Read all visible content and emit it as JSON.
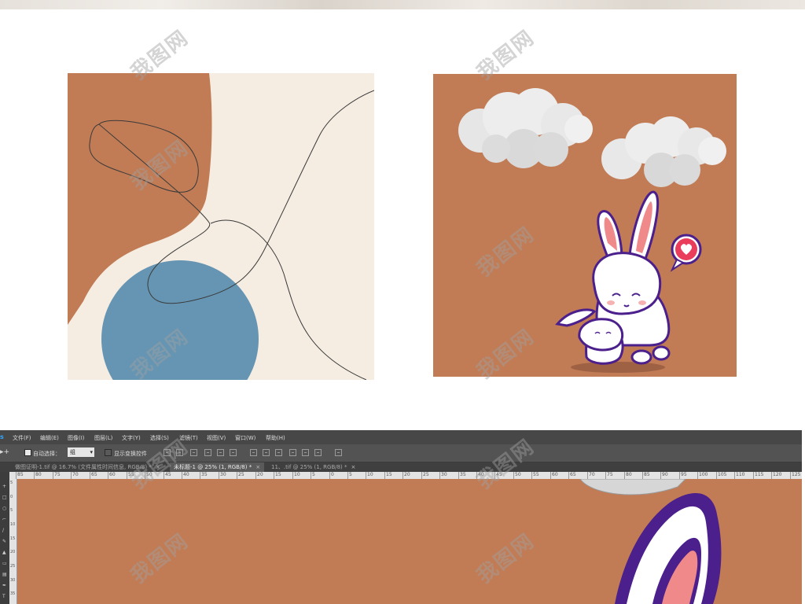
{
  "photoshop": {
    "app_glyph": "s",
    "menu": [
      "文件(F)",
      "编辑(E)",
      "图像(I)",
      "图层(L)",
      "文字(Y)",
      "选择(S)",
      "滤镜(T)",
      "视图(V)",
      "窗口(W)",
      "帮助(H)"
    ],
    "options": {
      "auto_select_label": "自动选择：",
      "auto_select_value": "组",
      "show_transform_label": "显示变换控件"
    },
    "tabs": [
      {
        "label": "做图证明-1.tif @ 16.7% (文件属性时间信息, RGB/8) *",
        "close": "×"
      },
      {
        "label": "未标题-1 @ 25% (1, RGB/8) *",
        "close": "×"
      },
      {
        "label": "11、.tif @ 25% (1, RGB/8) *",
        "close": "×"
      }
    ],
    "ruler_h_ticks": [
      "85",
      "80",
      "75",
      "70",
      "65",
      "60",
      "55",
      "50",
      "45",
      "40",
      "35",
      "30",
      "25",
      "20",
      "15",
      "10",
      "5",
      "0",
      "5",
      "10",
      "15",
      "20",
      "25",
      "30",
      "35",
      "40",
      "45",
      "50",
      "55",
      "60",
      "65",
      "70",
      "75",
      "80",
      "85",
      "90",
      "95",
      "100",
      "105",
      "110",
      "115",
      "120",
      "125"
    ],
    "ruler_v_ticks": [
      "5",
      "0",
      "5",
      "10",
      "15",
      "20",
      "25",
      "30",
      "35"
    ]
  },
  "colors": {
    "terracotta": "#c17c55",
    "cream": "#f5ece2",
    "blue": "#6595b3",
    "bunny_outline": "#4b1f8c",
    "ear_pink": "#f08a8a",
    "heart_red": "#ea3d5c"
  },
  "watermark_text": "我图网"
}
